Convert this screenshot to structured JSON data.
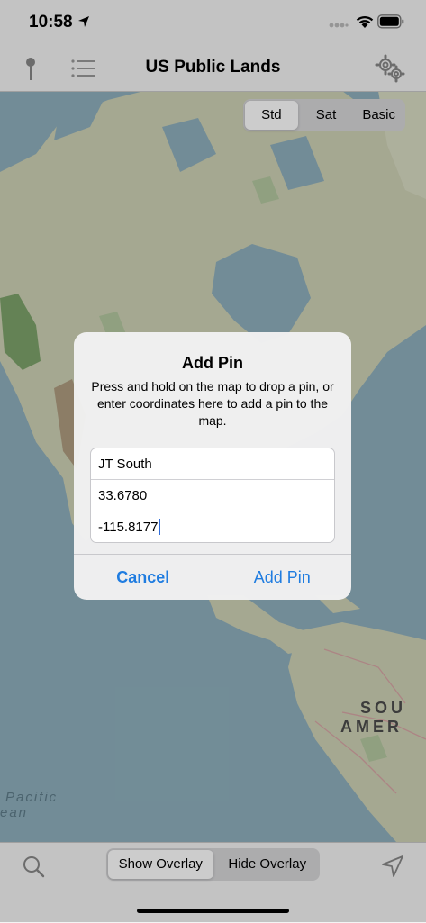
{
  "status": {
    "time": "10:58"
  },
  "nav": {
    "title": "US Public Lands"
  },
  "map_type": {
    "options": [
      "Std",
      "Sat",
      "Basic"
    ],
    "selected": "Std"
  },
  "map_labels": {
    "continent_1": "SOU",
    "continent_2": "AMER",
    "ocean_1": "Pacific",
    "ocean_2": "ean"
  },
  "alert": {
    "title": "Add Pin",
    "message": "Press and hold on the map to drop a pin, or enter coordinates here to add a pin to the map.",
    "fields": {
      "name": "JT South",
      "latitude": "33.6780",
      "longitude": "-115.8177"
    },
    "cancel_label": "Cancel",
    "confirm_label": "Add Pin"
  },
  "overlay_toggle": {
    "options": [
      "Show Overlay",
      "Hide Overlay"
    ],
    "selected": "Show Overlay"
  },
  "colors": {
    "accent": "#1f7ce0",
    "ocean": "#8fb0bd",
    "land": "#cfd2b6",
    "bar": "#f4f4f4"
  }
}
